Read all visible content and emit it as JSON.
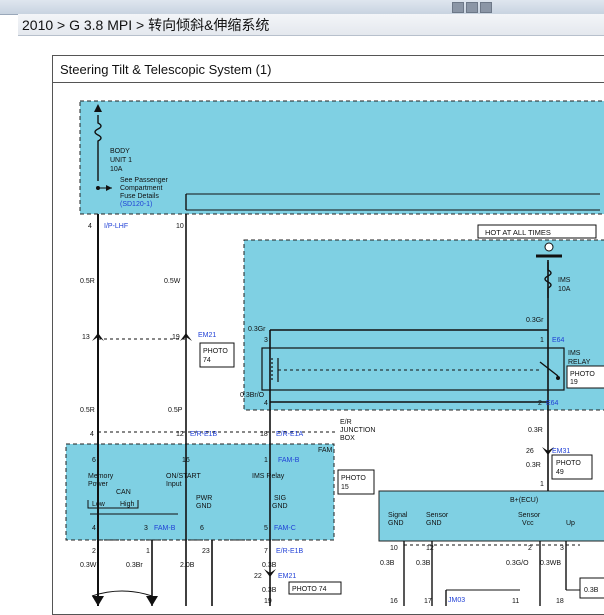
{
  "breadcrumb": {
    "text": "2010 > G 3.8 MPI > 转向倾斜&伸缩系统"
  },
  "diagram": {
    "title": "Steering Tilt & Telescopic System (1)",
    "fuse_box": {
      "line1": "BODY",
      "line2": "UNIT 1",
      "line3": "10A",
      "note1": "See Passenger",
      "note2": "Compartment",
      "note3": "Fuse Details",
      "ref": "(SD120-1)"
    },
    "hot_label": "HOT AT ALL TIMES",
    "ims_fuse": {
      "name": "IMS",
      "rating": "10A"
    },
    "ims_relay": {
      "l1": "IMS",
      "l2": "RELAY"
    },
    "connectors": {
      "iplhf_pin": "4",
      "iplhf": "I/P-LHF",
      "pin10": "10",
      "em21_a": "EM21",
      "em21_b": "EM21",
      "e64_a": "E64",
      "e64_b": "E64",
      "er_e1b_a": "E/R-E1B",
      "er_e1b_b": "E/R-E1B",
      "er_e1a": "E/R-E1A",
      "famb_a": "FAM-B",
      "famb_b": "FAM-B",
      "famc": "FAM-C",
      "em31": "EM31",
      "jm03": "JM03"
    },
    "pins": {
      "p13": "13",
      "p19": "19",
      "p3": "3",
      "p1": "1",
      "p4": "4",
      "p2": "2",
      "p4b": "4",
      "p12": "12",
      "p18": "18",
      "p1b": "1",
      "p6": "6",
      "p16": "16",
      "p1c": "1",
      "p4c": "4",
      "p3b": "3",
      "p6b": "6",
      "p5": "5",
      "p2b": "2",
      "p1d": "1",
      "p23": "23",
      "p7": "7",
      "p26": "26",
      "p1e": "1",
      "p22": "22",
      "p19b": "19",
      "p10": "10",
      "p12b": "12",
      "p2c": "2",
      "p3c": "3",
      "p16b": "16",
      "p17": "17",
      "p11": "11",
      "p18b": "18"
    },
    "wires": {
      "w05r": "0.5R",
      "w05w": "0.5W",
      "w03gr_a": "0.3Gr",
      "w03gr_b": "0.3Gr",
      "w05r_b": "0.5R",
      "w05p": "0.5P",
      "w03bro": "0.3Br/O",
      "w03r": "0.3R",
      "w03r_b": "0.3R",
      "w03w": "0.3W",
      "w03br": "0.3Br",
      "w20b": "2.0B",
      "w03b_a": "0.3B",
      "w03b_b": "0.3B",
      "w03b_c": "0.3B",
      "w03b_d": "0.3B",
      "w03go": "0.3G/O",
      "w03wb": "0.3WB",
      "w03b_e": "0.3B"
    },
    "photos": {
      "photo74_a": "PHOTO",
      "photo74_a_n": "74",
      "photo19": "PHOTO",
      "photo19_n": "19",
      "photo49": "PHOTO",
      "photo49_n": "49",
      "photo15": "PHOTO",
      "photo15_n": "15",
      "photo74_b": "PHOTO 74"
    },
    "junction": {
      "l1": "E/R",
      "l2": "JUNCTION",
      "l3": "BOX",
      "fam": "FAM"
    },
    "fam_box": {
      "mem1": "Memory",
      "mem2": "Power",
      "on1": "ON/START",
      "on2": "Input",
      "ims": "IMS Relay",
      "can": "CAN",
      "low": "Low",
      "high": "High",
      "pwr1": "PWR",
      "pwr2": "GND",
      "sig1": "SIG",
      "sig2": "GND"
    },
    "ecu": {
      "title": "B+(ECU)",
      "sig1": "Signal",
      "sig2": "GND",
      "sen1": "Sensor",
      "sen2": "GND",
      "vcc1": "Sensor",
      "vcc2": "Vcc",
      "up": "Up"
    },
    "colors": {
      "module_fill": "#7fd0e3",
      "wire": "#000000",
      "link_blue": "#1f3fd6"
    }
  }
}
